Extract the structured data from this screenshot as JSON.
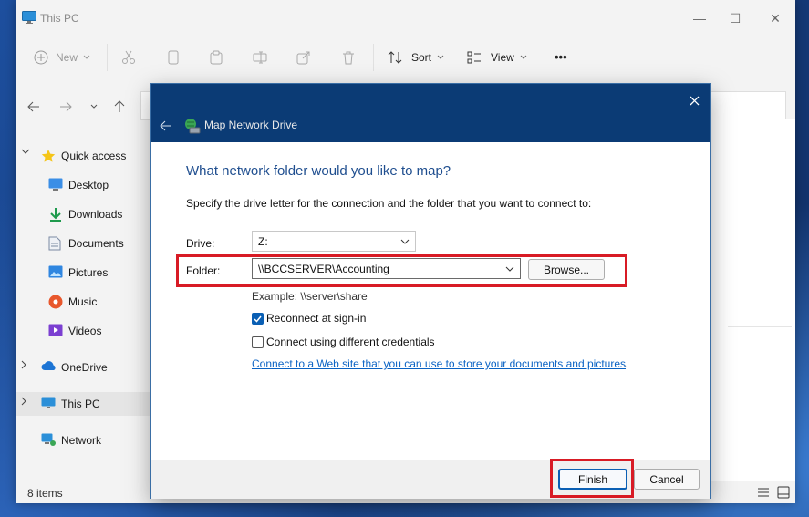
{
  "window": {
    "title": "This PC",
    "controls": {
      "minimize": "—",
      "maximize": "☐",
      "close": "✕"
    }
  },
  "toolbar": {
    "new_label": "New",
    "sort_label": "Sort",
    "view_label": "View",
    "more_label": "•••"
  },
  "sidebar": {
    "quick_access": "Quick access",
    "items": [
      {
        "label": "Desktop",
        "icon": "desktop-icon"
      },
      {
        "label": "Downloads",
        "icon": "download-icon"
      },
      {
        "label": "Documents",
        "icon": "documents-icon"
      },
      {
        "label": "Pictures",
        "icon": "pictures-icon"
      },
      {
        "label": "Music",
        "icon": "music-icon"
      },
      {
        "label": "Videos",
        "icon": "videos-icon"
      }
    ],
    "onedrive": "OneDrive",
    "this_pc": "This PC",
    "network": "Network"
  },
  "status": {
    "items_count": "8 items"
  },
  "dialog": {
    "title": "Map Network Drive",
    "heading": "What network folder would you like to map?",
    "description": "Specify the drive letter for the connection and the folder that you want to connect to:",
    "drive_label": "Drive:",
    "drive_value": "Z:",
    "folder_label": "Folder:",
    "folder_value": "\\\\BCCSERVER\\Accounting",
    "browse_label": "Browse...",
    "example": "Example: \\\\server\\share",
    "reconnect_label": "Reconnect at sign-in",
    "reconnect_checked": true,
    "credentials_label": "Connect using different credentials",
    "credentials_checked": false,
    "link_text": "Connect to a Web site that you can use to store your documents and pictures",
    "link_suffix": ".",
    "finish_label": "Finish",
    "cancel_label": "Cancel"
  },
  "colors": {
    "dialog_header": "#0b3b75",
    "heading_blue": "#1f4e8f",
    "highlight_red": "#d81b25",
    "link_blue": "#0b63c4",
    "checkbox_blue": "#0a5fb4"
  }
}
